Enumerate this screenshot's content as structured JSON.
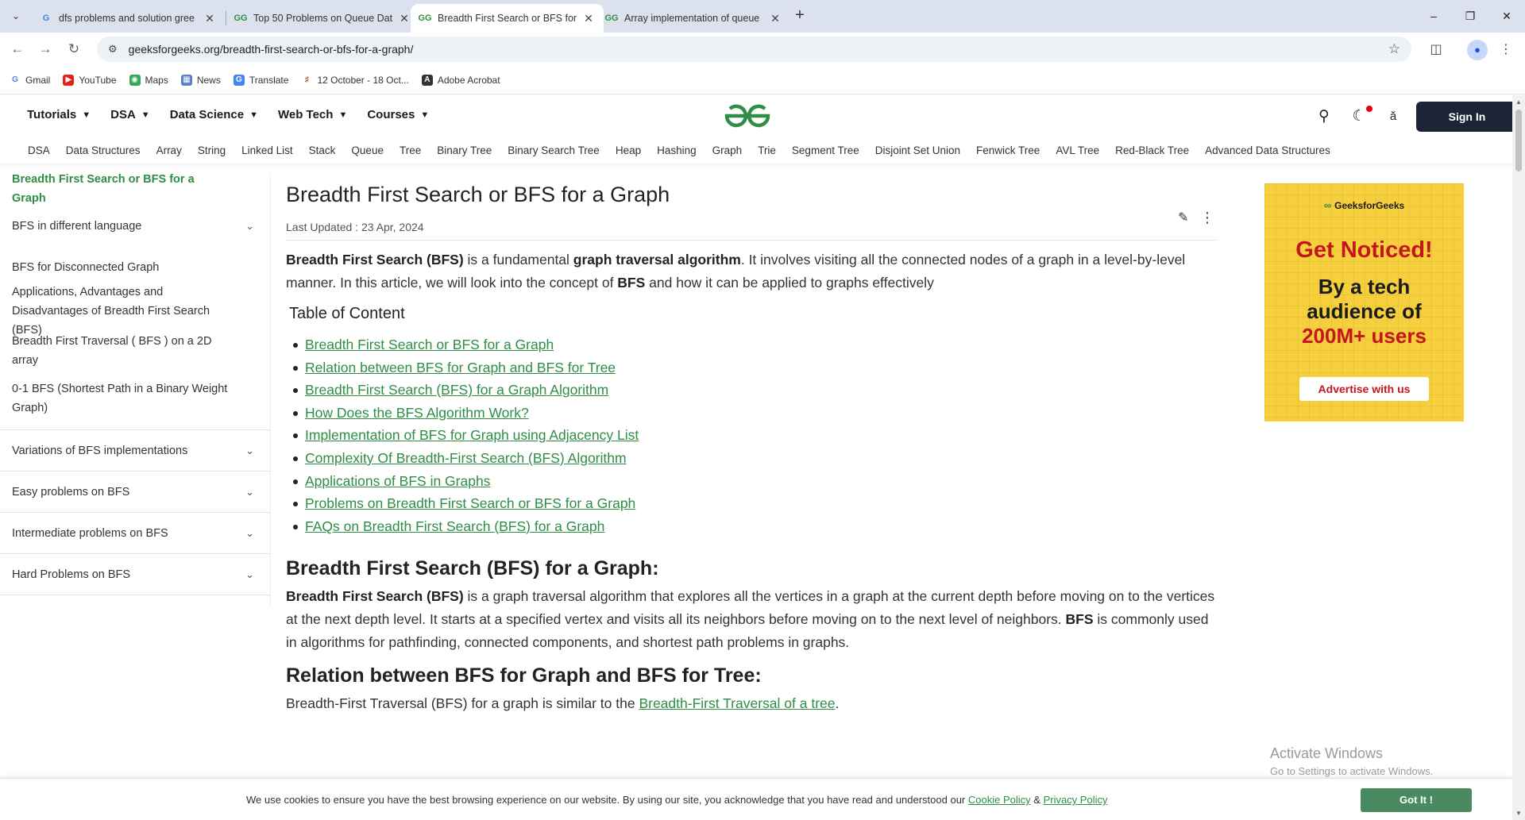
{
  "browser": {
    "tabs": [
      {
        "title": "dfs problems and solution gree",
        "icon": "google-icon",
        "active": false
      },
      {
        "title": "Top 50 Problems on Queue Dat",
        "icon": "gfg-icon",
        "active": false
      },
      {
        "title": "Breadth First Search or BFS for",
        "icon": "gfg-icon",
        "active": true
      },
      {
        "title": "Array implementation of queue",
        "icon": "gfg-icon",
        "active": false
      }
    ],
    "new_tab": "+",
    "url": "geeksforgeeks.org/breadth-first-search-or-bfs-for-a-graph/",
    "bookmarks": [
      {
        "label": "Gmail",
        "icon": "gmail-icon",
        "color": "#4285f4"
      },
      {
        "label": "YouTube",
        "icon": "youtube-icon",
        "color": "#e62117"
      },
      {
        "label": "Maps",
        "icon": "maps-icon",
        "color": "#34a853"
      },
      {
        "label": "News",
        "icon": "news-icon",
        "color": "#5b7fc9"
      },
      {
        "label": "Translate",
        "icon": "translate-icon",
        "color": "#4285f4"
      },
      {
        "label": "12 October - 18 Oct...",
        "icon": "bookmark-icon",
        "color": "#8b3a1a"
      },
      {
        "label": "Adobe Acrobat",
        "icon": "acrobat-icon",
        "color": "#333333"
      }
    ]
  },
  "site": {
    "main_nav": [
      "Tutorials",
      "DSA",
      "Data Science",
      "Web Tech",
      "Courses"
    ],
    "sign_in": "Sign In",
    "sub_nav": [
      "DSA",
      "Data Structures",
      "Array",
      "String",
      "Linked List",
      "Stack",
      "Queue",
      "Tree",
      "Binary Tree",
      "Binary Search Tree",
      "Heap",
      "Hashing",
      "Graph",
      "Trie",
      "Segment Tree",
      "Disjoint Set Union",
      "Fenwick Tree",
      "AVL Tree",
      "Red-Black Tree",
      "Advanced Data Structures"
    ],
    "brand_color": "#2f8d46"
  },
  "sidebar": {
    "items": [
      {
        "label": "Breadth First Search or BFS for a Graph",
        "active": true,
        "expandable": false
      },
      {
        "label": "BFS in different language",
        "active": false,
        "expandable": true
      },
      {
        "label": "BFS for Disconnected Graph",
        "active": false,
        "expandable": false
      },
      {
        "label": "Applications, Advantages and Disadvantages of Breadth First Search (BFS)",
        "active": false,
        "expandable": false
      },
      {
        "label": "Breadth First Traversal ( BFS ) on a 2D array",
        "active": false,
        "expandable": false
      },
      {
        "label": "0-1 BFS (Shortest Path in a Binary Weight Graph)",
        "active": false,
        "expandable": false
      },
      {
        "label": "Variations of BFS implementations",
        "active": false,
        "expandable": true
      },
      {
        "label": "Easy problems on BFS",
        "active": false,
        "expandable": true
      },
      {
        "label": "Intermediate problems on BFS",
        "active": false,
        "expandable": true
      },
      {
        "label": "Hard Problems on BFS",
        "active": false,
        "expandable": true
      }
    ]
  },
  "article": {
    "title": "Breadth First Search or BFS for a Graph",
    "updated": "Last Updated : 23 Apr, 2024",
    "intro": {
      "b1": "Breadth First Search (BFS)",
      "t1": " is a fundamental ",
      "b2": "graph traversal algorithm",
      "t2": ". It involves visiting all the connected nodes of a graph in a level-by-level manner. In this article, we will look into the concept of ",
      "b3": "BFS",
      "t3": " and how it can be applied to graphs effectively"
    },
    "toc_title": "Table of Content",
    "toc": [
      "Breadth First Search or BFS for a Graph",
      "Relation between BFS for Graph and BFS for Tree",
      "Breadth First Search (BFS) for a Graph Algorithm",
      "How Does the BFS Algorithm Work?",
      "Implementation of BFS for Graph using Adjacency List",
      "Complexity Of Breadth-First Search (BFS) Algorithm",
      "Applications of BFS in Graphs",
      "Problems on Breadth First Search or BFS for a Graph",
      "FAQs on Breadth First Search (BFS) for a Graph"
    ],
    "section1": {
      "heading": "Breadth First Search (BFS) for a Graph:",
      "b1": "Breadth First Search (BFS)",
      "t1": " is a graph traversal algorithm that explores all the vertices in a graph at the current depth before moving on to the vertices at the next depth level. It starts at a specified vertex and visits all its neighbors before moving on to the next level of neighbors. ",
      "b2": "BFS",
      "t2": " is commonly used in algorithms for pathfinding, connected components, and shortest path problems in graphs."
    },
    "section2": {
      "heading": "Relation between BFS for Graph and BFS for Tree:",
      "t1": "Breadth-First Traversal (BFS) for a graph is similar to the ",
      "link": "Breadth-First Traversal of a tree",
      "t2": "."
    }
  },
  "ad": {
    "brand": "GeeksforGeeks",
    "headline": "Get Noticed!",
    "line1": "By a tech audience of",
    "line2": "200M+ users",
    "button": "Advertise with us"
  },
  "watermark": {
    "line1": "Activate Windows",
    "line2": "Go to Settings to activate Windows."
  },
  "cookie": {
    "text": "We use cookies to ensure you have the best browsing experience on our website. By using our site, you acknowledge that you have read and understood our ",
    "cookie_policy": "Cookie Policy",
    "amp": " & ",
    "privacy_policy": "Privacy Policy",
    "button": "Got It !"
  }
}
